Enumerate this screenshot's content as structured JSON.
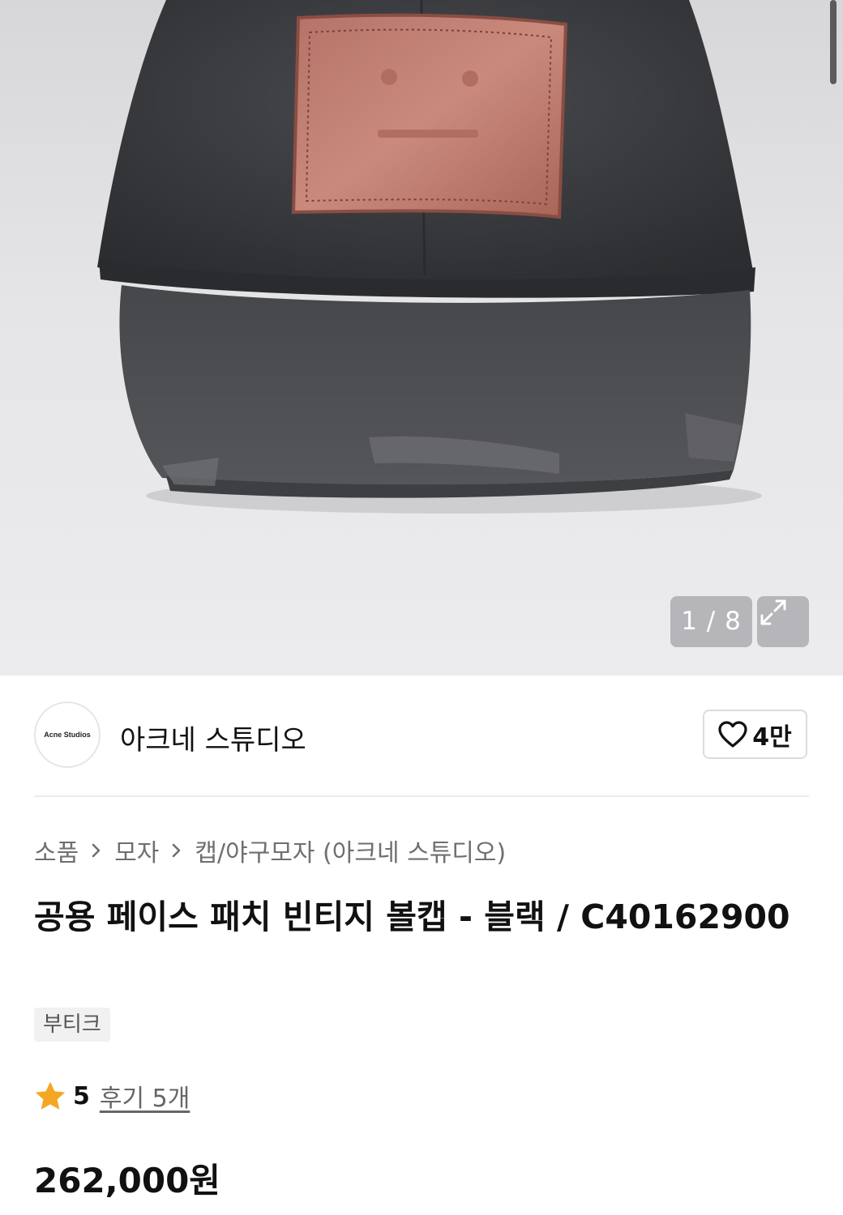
{
  "image_viewer": {
    "counter": "1 / 8",
    "expand_icon": "expand-arrows-icon",
    "product_image": "black distressed ball cap with pink leather face patch"
  },
  "brand": {
    "logo_text": "Acne Studios",
    "name": "아크네 스튜디오",
    "like_icon": "heart-outline-icon",
    "like_count": "4만"
  },
  "breadcrumb": {
    "items": [
      "소품",
      "모자",
      "캡/야구모자 (아크네 스튜디오)"
    ],
    "separator_icon": "chevron-right-icon"
  },
  "product": {
    "title": "공용 페이스 패치 빈티지 볼캡 - 블랙 / C40162900",
    "tag": "부티크",
    "rating": "5",
    "review_link": "후기 5개",
    "price": "262,000원"
  },
  "colors": {
    "star": "#f5a623",
    "text": "#111111",
    "muted": "#6f6f6f"
  }
}
